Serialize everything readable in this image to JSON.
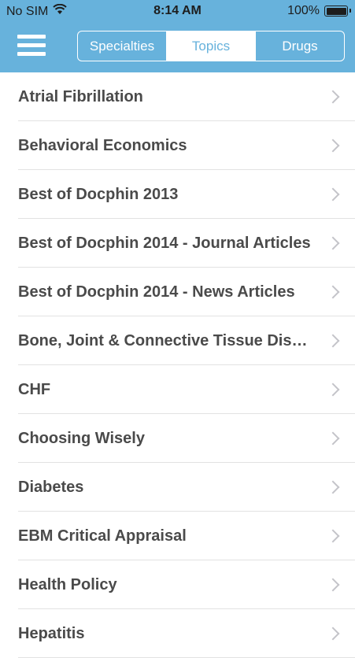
{
  "status_bar": {
    "carrier": "No SIM",
    "time": "8:14 AM",
    "battery_percent": "100%",
    "battery_level": 1.0
  },
  "header": {
    "menu_icon": "hamburger-menu-icon",
    "segments": [
      {
        "label": "Specialties",
        "selected": false
      },
      {
        "label": "Topics",
        "selected": true
      },
      {
        "label": "Drugs",
        "selected": false
      }
    ]
  },
  "colors": {
    "header_bg": "#67b2dc",
    "text": "#4a4a4a",
    "separator": "#e2e2e2",
    "chevron": "#c4c4c9"
  },
  "topics": [
    {
      "label": "Atrial Fibrillation"
    },
    {
      "label": "Behavioral Economics"
    },
    {
      "label": "Best of Docphin 2013"
    },
    {
      "label": "Best of Docphin 2014 - Journal Articles"
    },
    {
      "label": "Best of Docphin 2014 - News Articles"
    },
    {
      "label": "Bone, Joint & Connective Tissue Diso…"
    },
    {
      "label": "CHF"
    },
    {
      "label": "Choosing Wisely"
    },
    {
      "label": "Diabetes"
    },
    {
      "label": "EBM Critical Appraisal"
    },
    {
      "label": "Health Policy"
    },
    {
      "label": "Hepatitis"
    }
  ]
}
